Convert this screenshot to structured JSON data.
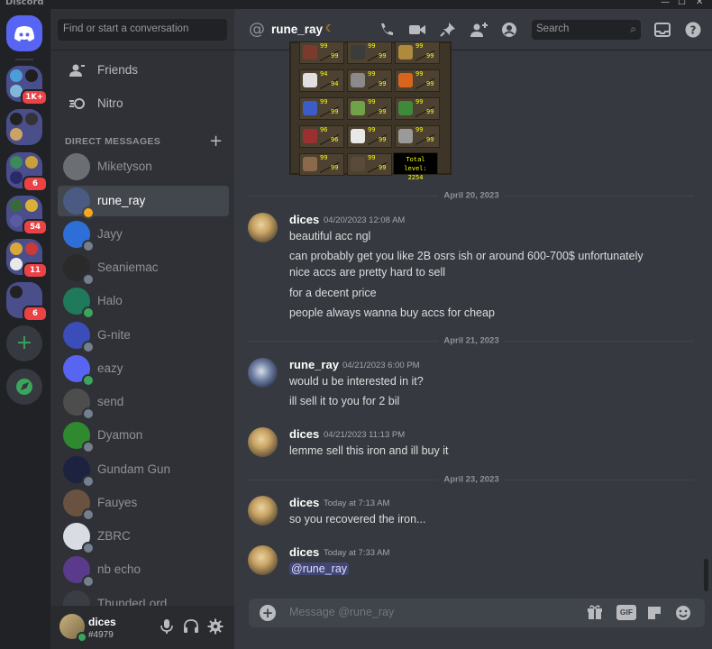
{
  "app": {
    "title": "Discord"
  },
  "window_controls": {
    "minimize": "—",
    "maximize": "☐",
    "close": "✕"
  },
  "servers": {
    "badges": [
      "1K+",
      "6",
      "54",
      "11",
      "6"
    ]
  },
  "sidebar": {
    "search_placeholder": "Find or start a conversation",
    "nav": [
      {
        "label": "Friends",
        "icon": "friends-icon"
      },
      {
        "label": "Nitro",
        "icon": "nitro-icon"
      }
    ],
    "dm_header": "DIRECT MESSAGES",
    "dms": [
      {
        "name": "Miketyson",
        "status": "none",
        "color": "#6b6e73"
      },
      {
        "name": "rune_ray",
        "status": "idle",
        "color": "#4a5a82"
      },
      {
        "name": "Jayy",
        "status": "offline",
        "color": "#2d6fd6"
      },
      {
        "name": "Seaniemac",
        "status": "offline",
        "color": "#2a2a2a"
      },
      {
        "name": "Halo",
        "status": "online",
        "color": "#1f7a5c"
      },
      {
        "name": "G-nite",
        "status": "offline",
        "color": "#3a4db8"
      },
      {
        "name": "eazy",
        "status": "online",
        "color": "#5865f2"
      },
      {
        "name": "send",
        "status": "offline",
        "color": "#4d4d4d"
      },
      {
        "name": "Dyamon",
        "status": "offline",
        "color": "#2f8a2f"
      },
      {
        "name": "Gundam Gun",
        "status": "offline",
        "color": "#1c2240"
      },
      {
        "name": "Fauyes",
        "status": "offline",
        "color": "#6a5240"
      },
      {
        "name": "ZBRC",
        "status": "offline",
        "color": "#d9dde3"
      },
      {
        "name": "nb echo",
        "status": "offline",
        "color": "#5a3a8a"
      },
      {
        "name": "ThunderLord",
        "status": "offline",
        "color": "#3a3d44"
      }
    ]
  },
  "user": {
    "name": "dices",
    "tag": "#4979"
  },
  "channel": {
    "name": "rune_ray",
    "search_placeholder": "Search"
  },
  "osrs_stats": {
    "rows": [
      [
        [
          "99",
          "99"
        ],
        [
          "99",
          "99"
        ],
        [
          "99",
          "99"
        ]
      ],
      [
        [
          "94",
          "94"
        ],
        [
          "99",
          "99"
        ],
        [
          "99",
          "99"
        ]
      ],
      [
        [
          "99",
          "99"
        ],
        [
          "99",
          "99"
        ],
        [
          "99",
          "99"
        ]
      ],
      [
        [
          "96",
          "96"
        ],
        [
          "99",
          "99"
        ],
        [
          "99",
          "99"
        ]
      ],
      [
        [
          "99",
          "99"
        ],
        [
          "99",
          "99"
        ]
      ]
    ],
    "icon_colors": [
      [
        "#7a3b2e",
        "#3c3c3c",
        "#b08a3c"
      ],
      [
        "#e0e0e0",
        "#8a8a8a",
        "#d9651c"
      ],
      [
        "#3c5cc9",
        "#6fa34a",
        "#3f8a3a"
      ],
      [
        "#9c2f2f",
        "#e8e8e8",
        "#9a9a9a"
      ],
      [
        "#8a6a4a",
        "#5a4a3a"
      ]
    ],
    "total_label": "Total level:",
    "total_value": "2254"
  },
  "messages": {
    "sep1": "April 20, 2023",
    "m1": {
      "author": "dices",
      "time": "04/20/2023 12:08 AM",
      "lines": [
        "beautiful acc ngl",
        "can probably get you like 2B osrs ish or around 600-700$ unfortunately",
        "nice accs are pretty hard to sell",
        "for a decent price",
        "people always wanna buy accs for cheap"
      ]
    },
    "sep2": "April 21, 2023",
    "m2": {
      "author": "rune_ray",
      "time": "04/21/2023 6:00 PM",
      "lines": [
        "would u be interested in it?",
        "ill sell it to you for 2 bil"
      ]
    },
    "m3": {
      "author": "dices",
      "time": "04/21/2023 11:13 PM",
      "lines": [
        "lemme sell this iron and ill buy it"
      ]
    },
    "sep3": "April 23, 2023",
    "m4": {
      "author": "dices",
      "time": "Today at 7:13 AM",
      "lines": [
        "so you recovered the iron..."
      ]
    },
    "m5": {
      "author": "dices",
      "time": "Today at 7:33 AM",
      "mention": "@rune_ray"
    }
  },
  "composer": {
    "placeholder": "Message @rune_ray",
    "gif_label": "GIF"
  }
}
